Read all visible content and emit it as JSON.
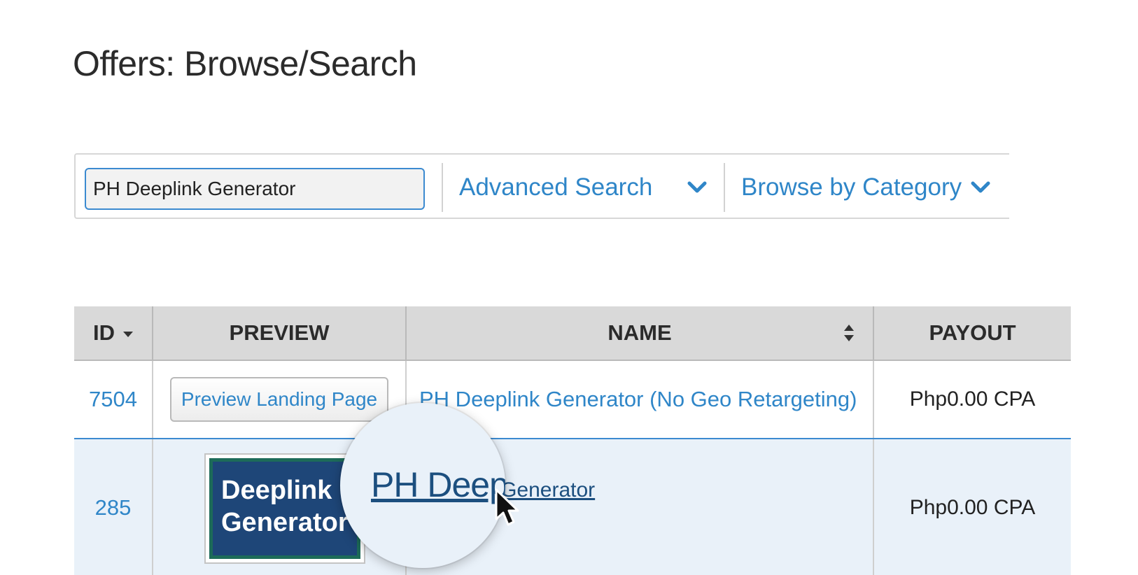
{
  "page": {
    "title": "Offers: Browse/Search"
  },
  "search": {
    "value": "PH Deeplink Generator",
    "advanced_label": "Advanced Search",
    "category_label": "Browse by Category"
  },
  "table": {
    "headers": {
      "id": "ID",
      "preview": "PREVIEW",
      "name": "NAME",
      "payout": "PAYOUT"
    },
    "rows": [
      {
        "id": "7504",
        "preview_label": "Preview Landing Page",
        "name": "PH Deeplink Generator (No Geo Retargeting)",
        "payout": "Php0.00 CPA"
      },
      {
        "id": "285",
        "thumbnail_text_1": "Deeplink",
        "thumbnail_text_2": "Generator",
        "name": "PH Deeplink Generator",
        "magnified_text": "PH Deeplink Generator",
        "payout": "Php0.00 CPA"
      }
    ]
  },
  "colors": {
    "link": "#2f86c8",
    "link_hover": "#1c4f7f",
    "header_bg": "#d9d9d9",
    "selected_row_bg": "#e9f1f9",
    "thumbnail_bg": "#1e4678",
    "thumbnail_border": "#1d6b59"
  },
  "icons": [
    "chevron-down-icon",
    "sort-desc-icon",
    "sort-both-icon",
    "mouse-cursor-icon"
  ]
}
